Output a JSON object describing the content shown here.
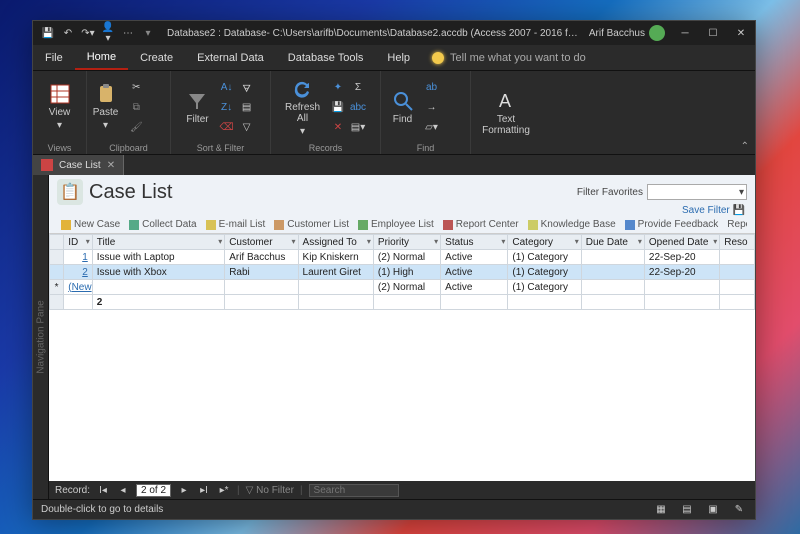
{
  "titlebar": {
    "title": "Database2 : Database- C:\\Users\\arifb\\Documents\\Database2.accdb (Access 2007 - 2016 file f…",
    "account_name": "Arif Bacchus"
  },
  "menu": {
    "file": "File",
    "home": "Home",
    "create": "Create",
    "external": "External Data",
    "tools": "Database Tools",
    "help": "Help",
    "tell": "Tell me what you want to do"
  },
  "ribbon": {
    "view": "View",
    "paste": "Paste",
    "filter": "Filter",
    "refresh": "Refresh\nAll",
    "find": "Find",
    "textfmt": "Text\nFormatting",
    "groups": {
      "views": "Views",
      "clipboard": "Clipboard",
      "sortfilter": "Sort & Filter",
      "records": "Records",
      "find": "Find"
    }
  },
  "objecttab": {
    "name": "Case List"
  },
  "navpane": {
    "label": "Navigation Pane"
  },
  "caselist": {
    "title": "Case List",
    "filter_fav_label": "Filter Favorites",
    "save_filter": "Save Filter",
    "links": [
      "New Case",
      "Collect Data",
      "E-mail List",
      "Customer List",
      "Employee List",
      "Report Center",
      "Knowledge Base",
      "Provide Feedback",
      "Reports"
    ],
    "columns": [
      "ID",
      "Title",
      "Customer",
      "Assigned To",
      "Priority",
      "Status",
      "Category",
      "Due Date",
      "Opened Date",
      "Reso"
    ],
    "rows": [
      {
        "id": "1",
        "title": "Issue with Laptop",
        "customer": "Arif Bacchus",
        "assigned": "Kip Kniskern",
        "priority": "(2) Normal",
        "status": "Active",
        "category": "(1) Category",
        "due": "",
        "opened": "22-Sep-20"
      },
      {
        "id": "2",
        "title": "Issue with Xbox",
        "customer": "Rabi",
        "assigned": "Laurent Giret",
        "priority": "(1) High",
        "status": "Active",
        "category": "(1) Category",
        "due": "",
        "opened": "22-Sep-20"
      }
    ],
    "newrow": {
      "id": "(New)",
      "priority": "(2) Normal",
      "status": "Active",
      "category": "(1) Category"
    },
    "sum": "2"
  },
  "recnav": {
    "label": "Record:",
    "pos": "2 of 2",
    "nofilter": "No Filter",
    "search_ph": "Search"
  },
  "status": {
    "left": "Double-click to go to details"
  }
}
